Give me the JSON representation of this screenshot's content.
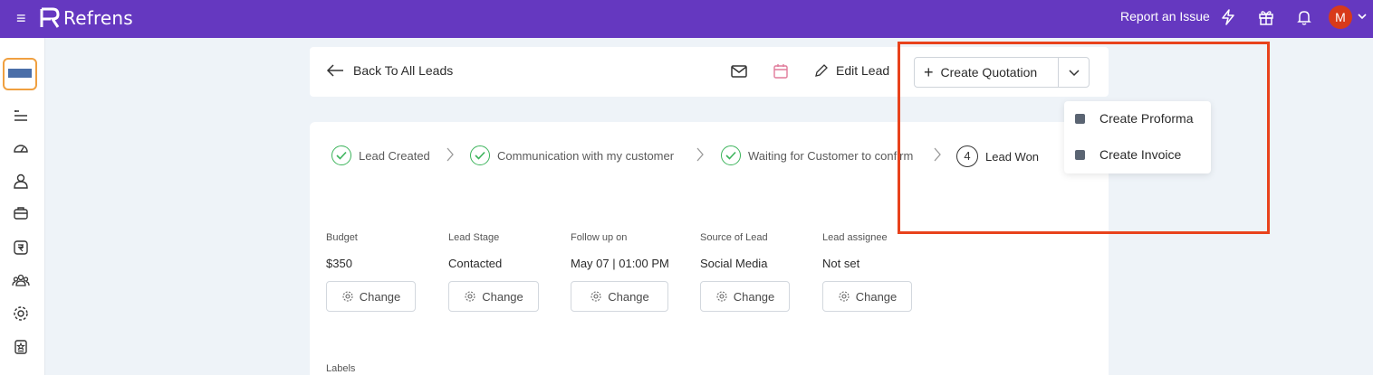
{
  "app": {
    "name": "Refrens",
    "brand_color": "#6538c0"
  },
  "topbar": {
    "report_issue": "Report an Issue",
    "icons": [
      "lightning-icon",
      "gift-icon",
      "bell-icon"
    ],
    "avatar_initial": "M"
  },
  "sidebar": {
    "icons": [
      "list-icon",
      "dashboard-icon",
      "user-icon",
      "briefcase-icon",
      "rupee-icon",
      "team-icon",
      "settings-icon",
      "badge-icon"
    ]
  },
  "header": {
    "back_label": "Back To All Leads",
    "edit_label": "Edit Lead",
    "create_quotation_label": "Create Quotation"
  },
  "dropdown": {
    "items": [
      {
        "label": "Create Proforma"
      },
      {
        "label": "Create Invoice"
      }
    ]
  },
  "progress": {
    "steps": [
      {
        "label": "Lead Created",
        "status": "done"
      },
      {
        "label": "Communication with my customer",
        "status": "done"
      },
      {
        "label": "Waiting for Customer to confirm",
        "status": "done"
      },
      {
        "label": "Lead Won",
        "status": "pending",
        "number": "4"
      }
    ]
  },
  "fields": [
    {
      "label": "Budget",
      "value": "$350",
      "action": "Change"
    },
    {
      "label": "Lead Stage",
      "value": "Contacted",
      "action": "Change"
    },
    {
      "label": "Follow up on",
      "value": "May 07 | 01:00 PM",
      "action": "Change"
    },
    {
      "label": "Source of Lead",
      "value": "Social Media",
      "action": "Change"
    },
    {
      "label": "Lead assignee",
      "value": "Not set",
      "action": "Change"
    }
  ],
  "labels_heading": "Labels",
  "colors": {
    "success": "#3cb45b",
    "highlight": "#e8421c"
  }
}
